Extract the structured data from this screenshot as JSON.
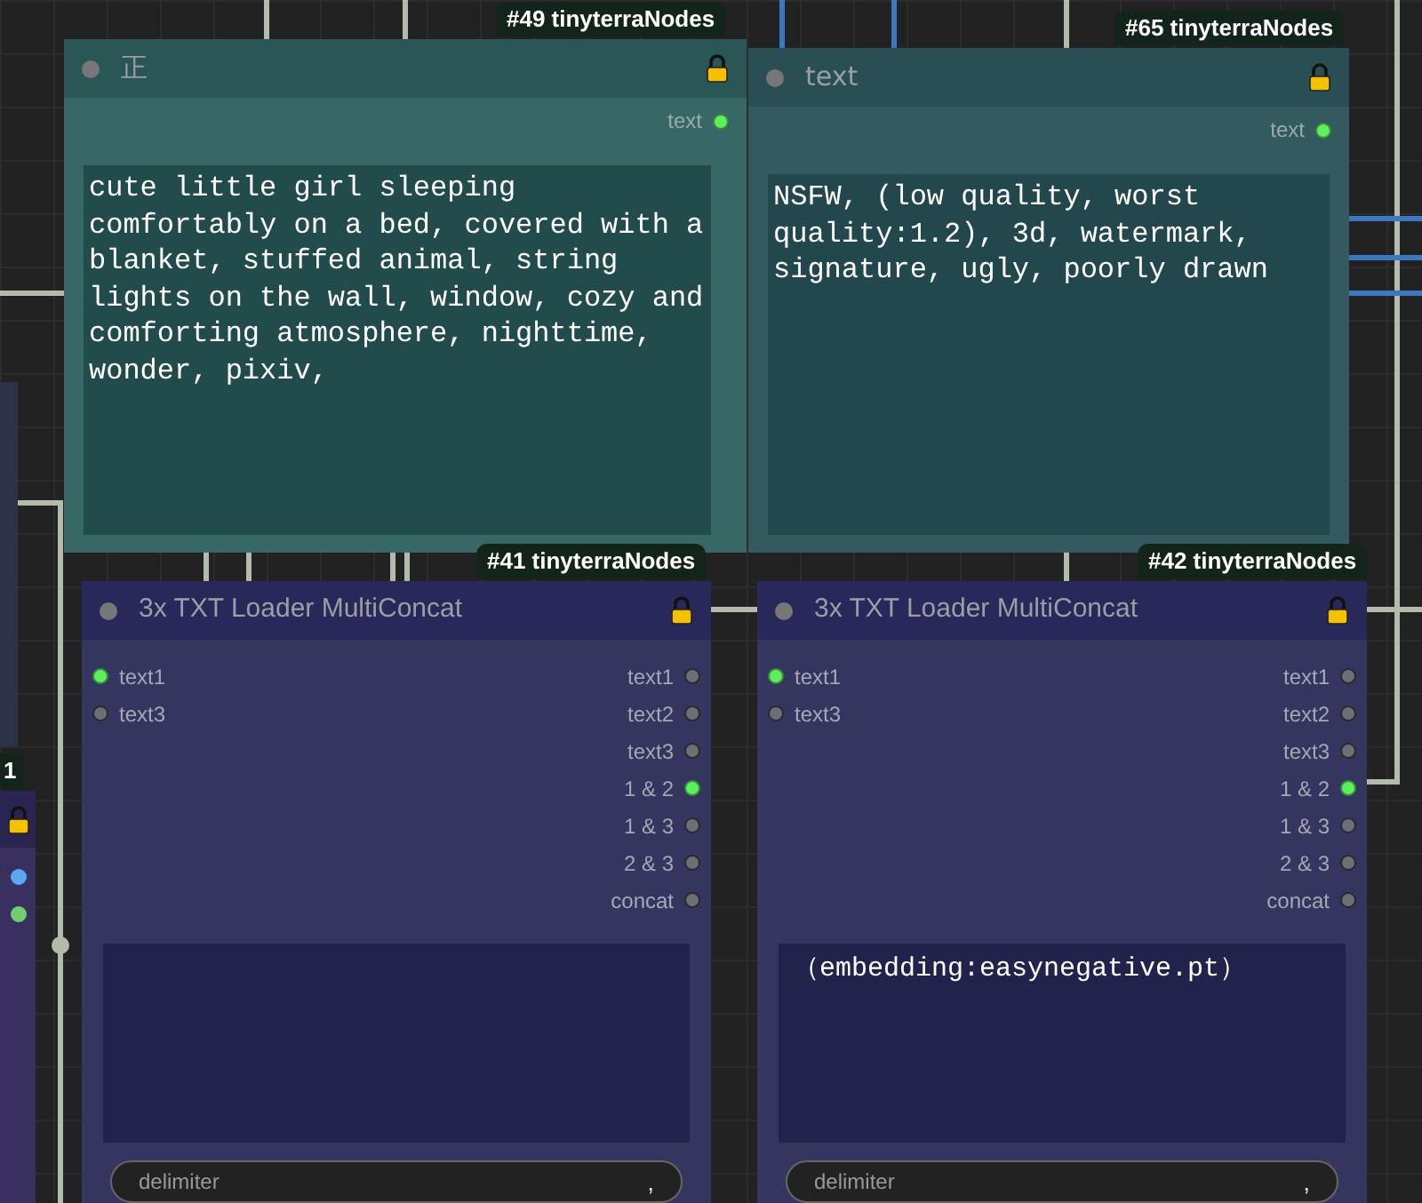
{
  "nodes": [
    {
      "kind": "text",
      "badge": "#49 tinyterraNodes",
      "title": "正",
      "locked": true,
      "outputs": [
        {
          "label": "text",
          "connected": true
        }
      ],
      "value": "cute little girl sleeping comfortably on a bed, covered with a blanket, stuffed animal, string lights on the wall, window, cozy and comforting atmosphere, nighttime, wonder, pixiv,"
    },
    {
      "kind": "text",
      "badge": "#65 tinyterraNodes",
      "title": "text",
      "locked": true,
      "outputs": [
        {
          "label": "text",
          "connected": true
        }
      ],
      "value": "NSFW, (low quality, worst quality:1.2), 3d, watermark, signature, ugly, poorly drawn"
    },
    {
      "kind": "concat",
      "badge": "#41 tinyterraNodes",
      "title": "3x TXT Loader MultiConcat",
      "locked": true,
      "inputs": [
        {
          "label": "text1",
          "connected": true
        },
        {
          "label": "text3",
          "connected": false
        }
      ],
      "outputs": [
        {
          "label": "text1",
          "connected": false
        },
        {
          "label": "text2",
          "connected": false
        },
        {
          "label": "text3",
          "connected": false
        },
        {
          "label": "1 & 2",
          "connected": true
        },
        {
          "label": "1 & 3",
          "connected": false
        },
        {
          "label": "2 & 3",
          "connected": false
        },
        {
          "label": "concat",
          "connected": false
        }
      ],
      "delimiter": {
        "label": "delimiter",
        "value": ","
      }
    },
    {
      "kind": "concat",
      "badge": "#42 tinyterraNodes",
      "title": "3x TXT Loader MultiConcat",
      "locked": true,
      "inputs": [
        {
          "label": "text1",
          "connected": true
        },
        {
          "label": "text3",
          "connected": false
        }
      ],
      "outputs": [
        {
          "label": "text1",
          "connected": false
        },
        {
          "label": "text2",
          "connected": false
        },
        {
          "label": "text3",
          "connected": false
        },
        {
          "label": "1 & 2",
          "connected": true
        },
        {
          "label": "1 & 3",
          "connected": false
        },
        {
          "label": "2 & 3",
          "connected": false
        },
        {
          "label": "concat",
          "connected": false
        }
      ],
      "value": "（embedding:easynegative.pt）",
      "delimiter": {
        "label": "delimiter",
        "value": ","
      }
    }
  ],
  "side_node": {
    "badge": "1",
    "locked": true,
    "slots": [
      {
        "color": "#5aa8f0"
      },
      {
        "color": "#6fcf6f"
      }
    ]
  }
}
